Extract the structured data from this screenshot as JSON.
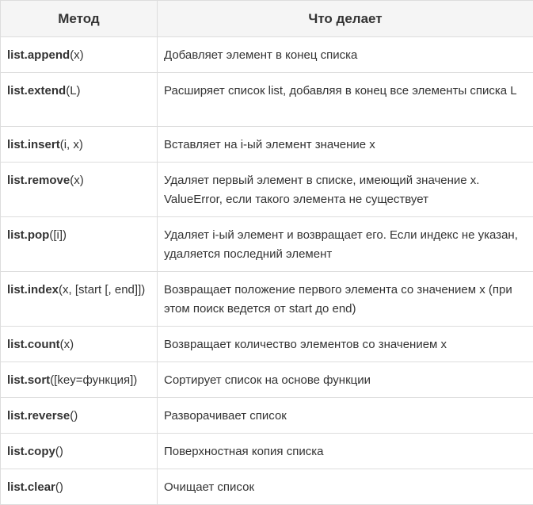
{
  "header": {
    "col_method": "Метод",
    "col_action": "Что делает"
  },
  "rows": [
    {
      "obj": "list.",
      "name": "append",
      "args": "(x)",
      "desc": "Добавляет элемент в конец списка"
    },
    {
      "obj": "list.",
      "name": "extend",
      "args": "(L)",
      "desc": "Расширяет список list, добавляя в конец все элементы списка L"
    },
    {
      "obj": "list.",
      "name": "insert",
      "args": "(i, x)",
      "desc": "Вставляет на i-ый элемент значение x"
    },
    {
      "obj": "list.",
      "name": "remove",
      "args": "(x)",
      "desc": "Удаляет первый элемент в списке, имеющий значение x. ValueError, если такого элемента не существует"
    },
    {
      "obj": "list.",
      "name": "pop",
      "args": "([i])",
      "desc": "Удаляет i-ый элемент и возвращает его. Если индекс не указан, удаляется последний элемент"
    },
    {
      "obj": "list.",
      "name": "index",
      "args": "(x, [start [, end]])",
      "desc": "Возвращает положение первого элемента со значением x (при этом поиск ведется от start до end)"
    },
    {
      "obj": "list.",
      "name": "count",
      "args": "(x)",
      "desc": "Возвращает количество элементов со значением x"
    },
    {
      "obj": "list.",
      "name": "sort",
      "args": "([key=функция])",
      "desc": "Сортирует список на основе функции"
    },
    {
      "obj": "list.",
      "name": "reverse",
      "args": "()",
      "desc": "Разворачивает список"
    },
    {
      "obj": "list.",
      "name": "copy",
      "args": "()",
      "desc": "Поверхностная копия списка"
    },
    {
      "obj": "list.",
      "name": "clear",
      "args": "()",
      "desc": "Очищает список"
    }
  ]
}
